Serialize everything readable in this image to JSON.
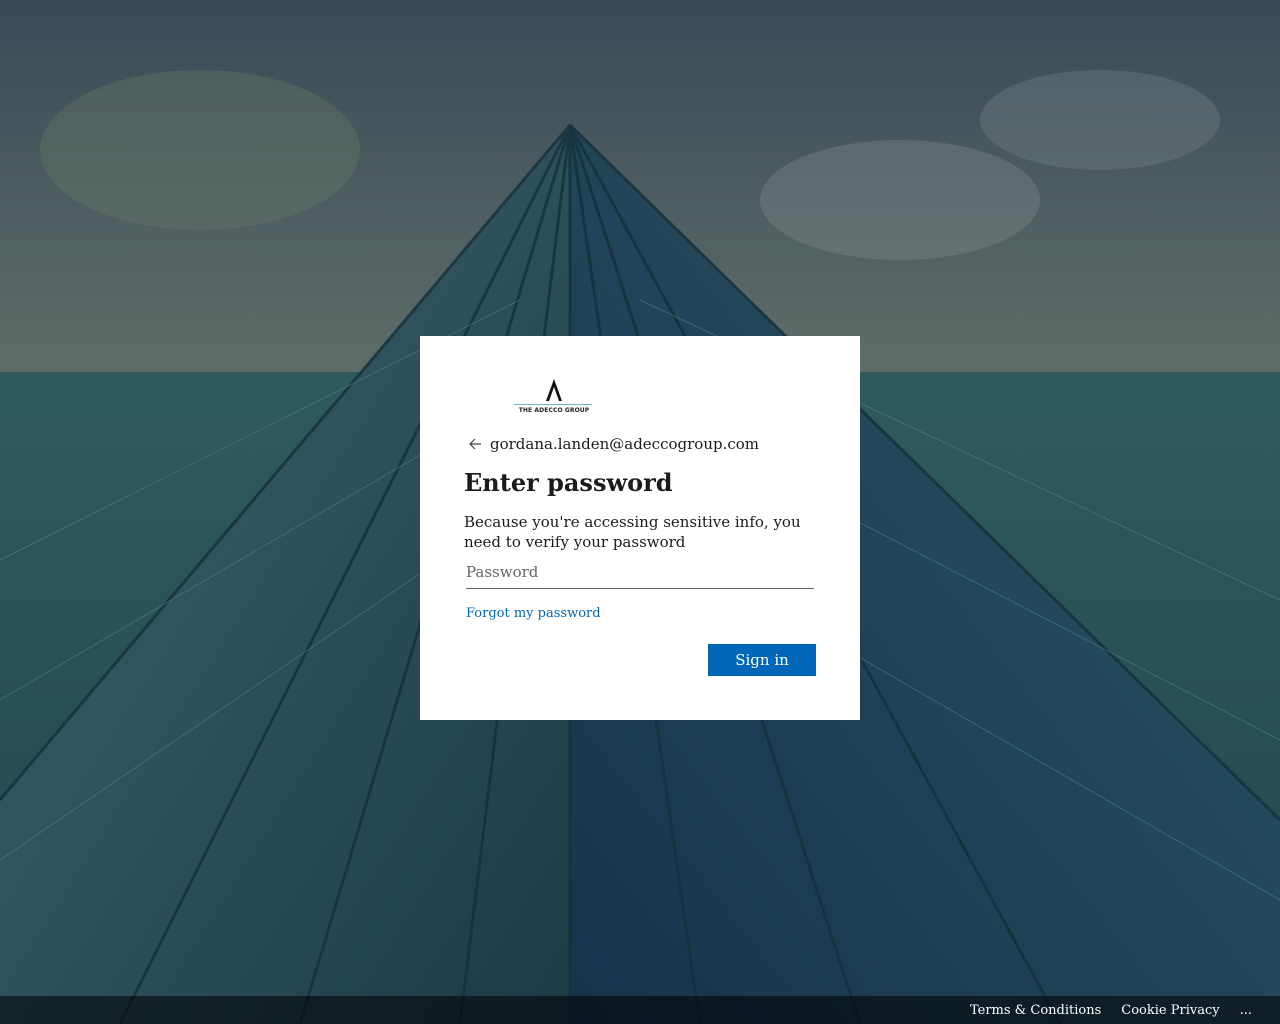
{
  "brand": {
    "logo_text": "THE ADECCO GROUP"
  },
  "identity": {
    "email": "gordana.landen@adeccogroup.com"
  },
  "main": {
    "title": "Enter password",
    "description": "Because you're accessing sensitive info, you need to verify your password",
    "password_placeholder": "Password",
    "forgot_label": "Forgot my password",
    "signin_label": "Sign in"
  },
  "footer": {
    "terms": "Terms & Conditions",
    "cookie": "Cookie Privacy",
    "more": "..."
  },
  "colors": {
    "accent": "#0067b8",
    "card": "#ffffff"
  },
  "icons": {
    "back": "back-arrow-icon",
    "logo": "adecco-logo"
  }
}
